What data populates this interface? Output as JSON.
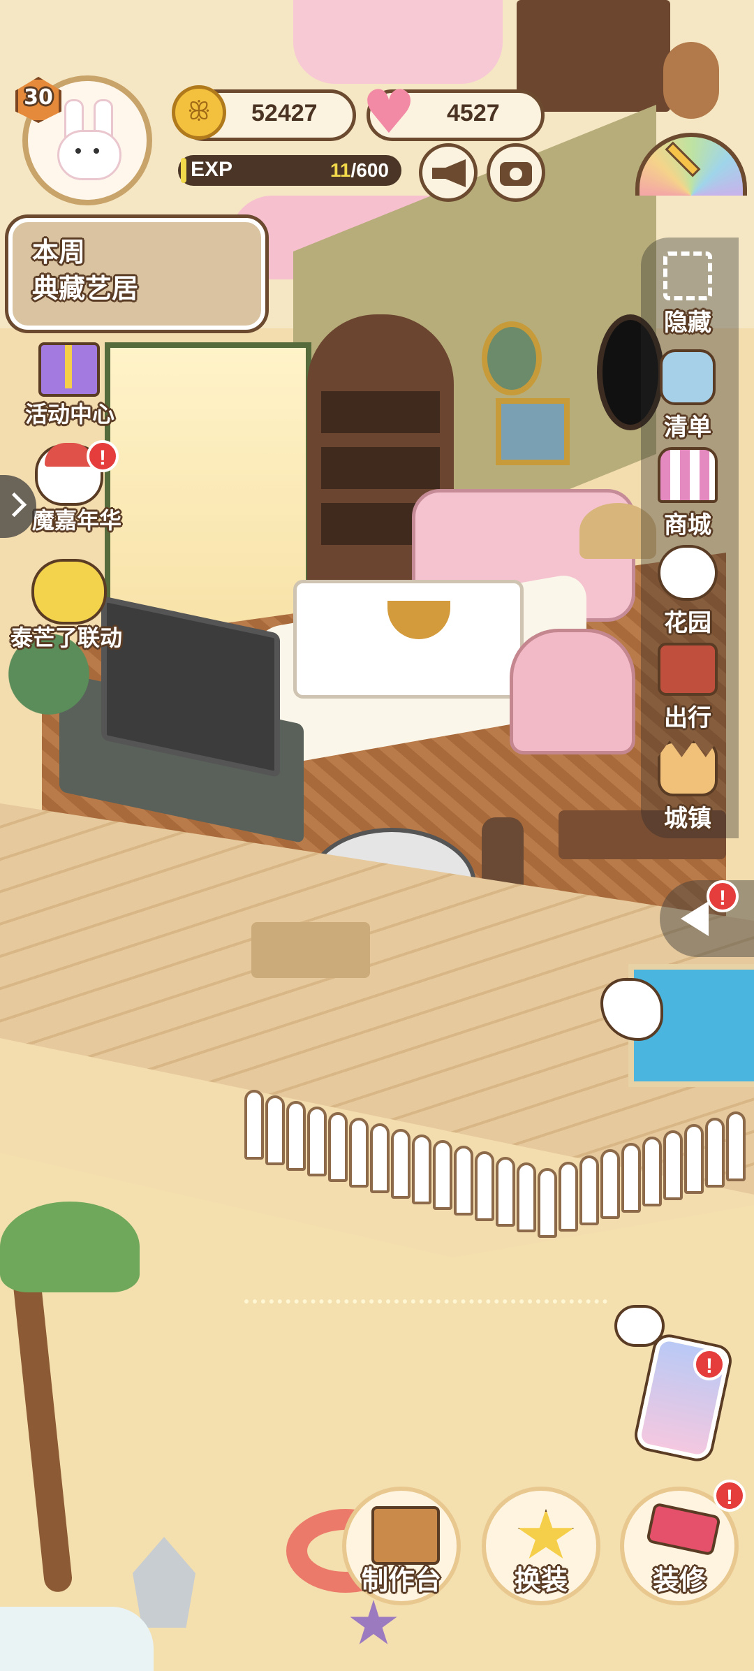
{
  "player": {
    "level": "30",
    "avatar": "bunny-avatar"
  },
  "currency": {
    "coins": "52427",
    "hearts": "4527"
  },
  "exp": {
    "label": "EXP",
    "current": "11",
    "max": "/600",
    "progress": 0.018
  },
  "banner": {
    "line1": "本周",
    "line2": "典藏艺居"
  },
  "left_menu": [
    {
      "label": "活动中心",
      "icon": "gift-icon"
    },
    {
      "label": "魔嘉年华",
      "icon": "jester-icon",
      "badge": "!"
    },
    {
      "label": "泰芒了联动",
      "icon": "mango-cat-icon"
    }
  ],
  "right_menu": [
    {
      "label": "隐藏",
      "icon": "hide-frame-icon"
    },
    {
      "label": "清单",
      "icon": "checklist-icon"
    },
    {
      "label": "商城",
      "icon": "shop-icon"
    },
    {
      "label": "花园",
      "icon": "garden-icon"
    },
    {
      "label": "出行",
      "icon": "luggage-icon"
    },
    {
      "label": "城镇",
      "icon": "castle-icon"
    }
  ],
  "bottom_menu": [
    {
      "label": "制作台",
      "icon": "workbench-icon"
    },
    {
      "label": "换装",
      "icon": "outfit-icon"
    },
    {
      "label": "装修",
      "icon": "paint-roller-icon",
      "badge": "!"
    }
  ],
  "badges": {
    "alert": "!"
  },
  "colors": {
    "outline": "#5a3b24",
    "badge": "#e53c3c",
    "exp_text": "#f2d94b",
    "hud_bg": "#fbf3df"
  }
}
